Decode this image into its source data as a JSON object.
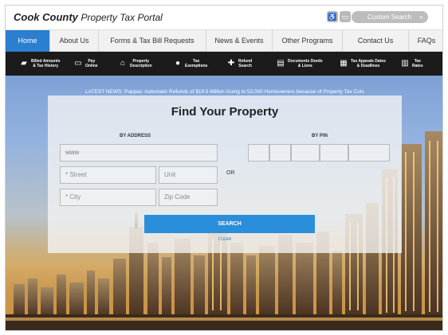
{
  "header": {
    "logo_bold": "Cook County",
    "logo_light": "Property Tax Portal",
    "search_placeholder": "Custom Search"
  },
  "topnav": {
    "tabs": [
      {
        "label": "Home",
        "active": true
      },
      {
        "label": "About Us"
      },
      {
        "label": "Forms & Tax Bill Requests"
      },
      {
        "label": "News & Events"
      },
      {
        "label": "Other Programs"
      },
      {
        "label": "Contact Us"
      },
      {
        "label": "FAQs"
      }
    ]
  },
  "subnav": {
    "items": [
      {
        "label": "Billed Amounts\n& Tax History",
        "icon": "folder-icon"
      },
      {
        "label": "Pay\nOnline",
        "icon": "monitor-icon"
      },
      {
        "label": "Property\nDescription",
        "icon": "house-icon"
      },
      {
        "label": "Tax\nExemptions",
        "icon": "location-pin-icon"
      },
      {
        "label": "Refund\nSearch",
        "icon": "lifebuoy-icon"
      },
      {
        "label": "Documents Deeds\n& Liens",
        "icon": "documents-icon"
      },
      {
        "label": "Tax Appeals Dates\n& Deadlines",
        "icon": "calendar-icon"
      },
      {
        "label": "Tax\nRates",
        "icon": "bar-chart-icon"
      }
    ]
  },
  "news": {
    "text": "LATEST NEWS:  Pappas: Automatic Refunds of $19.5 Million Going to 53,000 Homeowners because of Property Tax Cuts"
  },
  "form": {
    "title": "Find Your Property",
    "by_address": "BY ADDRESS",
    "by_pin": "BY PIN",
    "house_value": "www",
    "street_placeholder": "* Street",
    "unit_placeholder": "Unit",
    "city_placeholder": "* City",
    "zip_placeholder": "Zip Code",
    "or_label": "OR",
    "search_label": "SEARCH",
    "clear_label": "CLEAR"
  },
  "colors": {
    "accent": "#2a7fcf",
    "button": "#2b8edb",
    "subnav_bg": "#1b1b1b"
  }
}
